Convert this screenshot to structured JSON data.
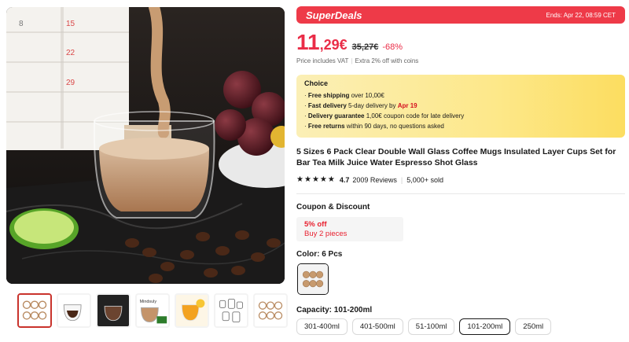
{
  "superdeals": {
    "brand": "SuperDeals",
    "ends": "Ends: Apr 22, 08:59 CET",
    "color": "#ee3a48"
  },
  "price": {
    "integer": "11",
    "decimal": ",29€",
    "original": "35,27€",
    "discount": "-68%",
    "color": "#ea2c47"
  },
  "vat": {
    "text": "Price includes VAT",
    "coins": "Extra 2% off with coins"
  },
  "choice": {
    "title": "Choice",
    "items": [
      {
        "bold": "Free shipping",
        "text": " over 10,00€"
      },
      {
        "bold": "Fast delivery",
        "text": " 5-day delivery by ",
        "highlight": "Apr 19"
      },
      {
        "bold": "Delivery guarantee",
        "text": "  1,00€ coupon code for late delivery"
      },
      {
        "bold": "Free returns",
        "text": "  within 90 days, no questions asked"
      }
    ]
  },
  "product": {
    "title": "5 Sizes 6 Pack Clear Double Wall Glass Coffee Mugs Insulated Layer Cups Set for Bar Tea Milk Juice Water Espresso Shot Glass",
    "rating": "4.7",
    "stars": 4.7,
    "reviews": "2009 Reviews",
    "sold": "5,000+ sold"
  },
  "coupon": {
    "label": "Coupon & Discount",
    "off": "5% off",
    "requirement": "Buy 2 pieces"
  },
  "color": {
    "label": "Color: 6 Pcs",
    "selected": "6 Pcs"
  },
  "capacity": {
    "label": "Capacity: 101-200ml",
    "options": [
      "301-400ml",
      "401-500ml",
      "51-100ml",
      "101-200ml",
      "250ml"
    ],
    "selected": "101-200ml"
  },
  "image": {
    "calendar_numbers": [
      "8",
      "15",
      "22",
      "29"
    ],
    "thumbnail_text": "Mindsuly"
  },
  "icons": {
    "star": "star-icon",
    "main_image": "product-photo",
    "swatch": "cups-swatch"
  }
}
